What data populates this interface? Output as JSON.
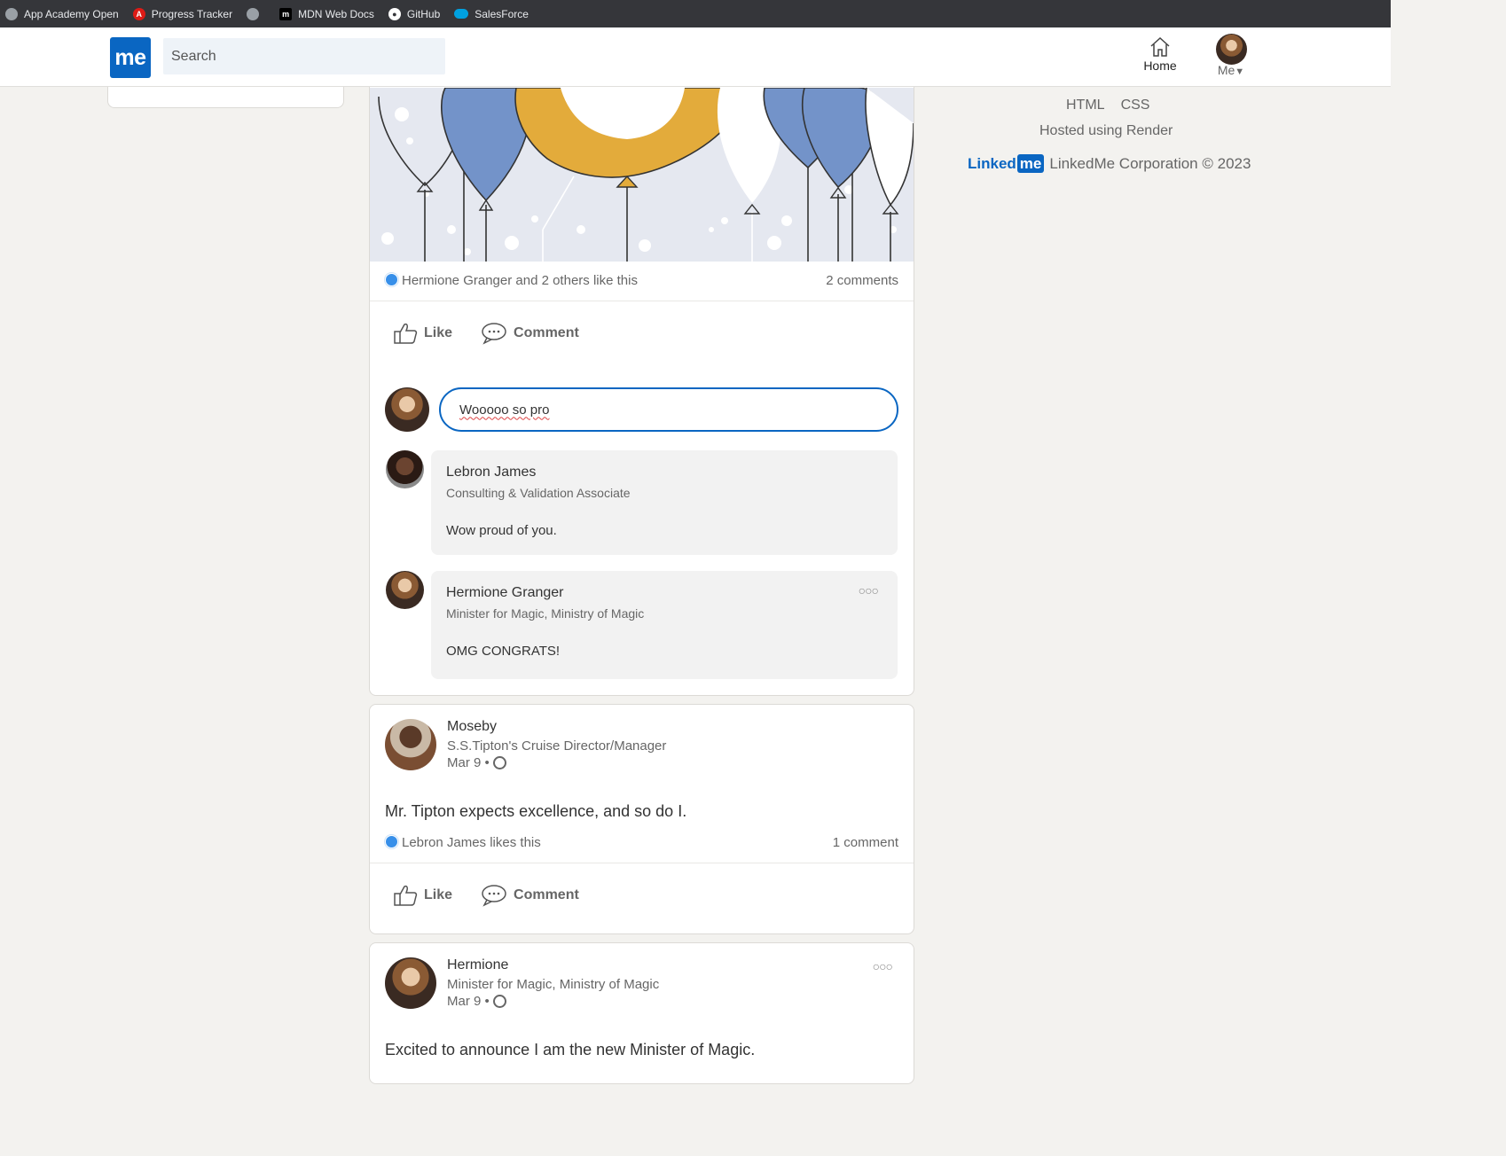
{
  "bookmarks": [
    {
      "label": "App Academy Open",
      "icon": "globe-icon"
    },
    {
      "label": "Progress Tracker",
      "icon": "angular-icon"
    },
    {
      "label": "",
      "icon": "globe-icon"
    },
    {
      "label": "MDN Web Docs",
      "icon": "mdn-icon"
    },
    {
      "label": "GitHub",
      "icon": "github-icon"
    },
    {
      "label": "SalesForce",
      "icon": "salesforce-icon"
    }
  ],
  "nav": {
    "logo": "me",
    "search_placeholder": "Search",
    "home_label": "Home",
    "me_label": "Me"
  },
  "feed": {
    "post1": {
      "likes_text": "Hermione Granger and 2 others like this",
      "comments_count": "2 comments",
      "like_label": "Like",
      "comment_label": "Comment",
      "comment_draft": "Wooooo so pro",
      "comments": [
        {
          "name": "Lebron James",
          "title": "Consulting & Validation Associate",
          "text": "Wow proud of you."
        },
        {
          "name": "Hermione Granger",
          "title": "Minister for Magic, Ministry of Magic",
          "text": "OMG CONGRATS!"
        }
      ]
    },
    "post2": {
      "author": "Moseby",
      "title": "S.S.Tipton's Cruise Director/Manager",
      "date": "Mar 9 •",
      "body": "Mr. Tipton expects excellence, and so do I.",
      "likes_text": "Lebron James likes this",
      "comments_count": "1 comment",
      "like_label": "Like",
      "comment_label": "Comment"
    },
    "post3": {
      "author": "Hermione",
      "title": "Minister for Magic, Ministry of Magic",
      "date": "Mar 9 •",
      "body": "Excited to announce I am the new Minister of Magic."
    }
  },
  "footer": {
    "links": [
      "HTML",
      "CSS"
    ],
    "hosted": "Hosted using Render",
    "brand_linked": "Linked",
    "brand_me": "me",
    "copyright": "LinkedMe Corporation © 2023"
  },
  "colors": {
    "brand": "#0a66c2",
    "balloon_blue": "#7393c9",
    "balloon_gold": "#e3ab3b"
  }
}
